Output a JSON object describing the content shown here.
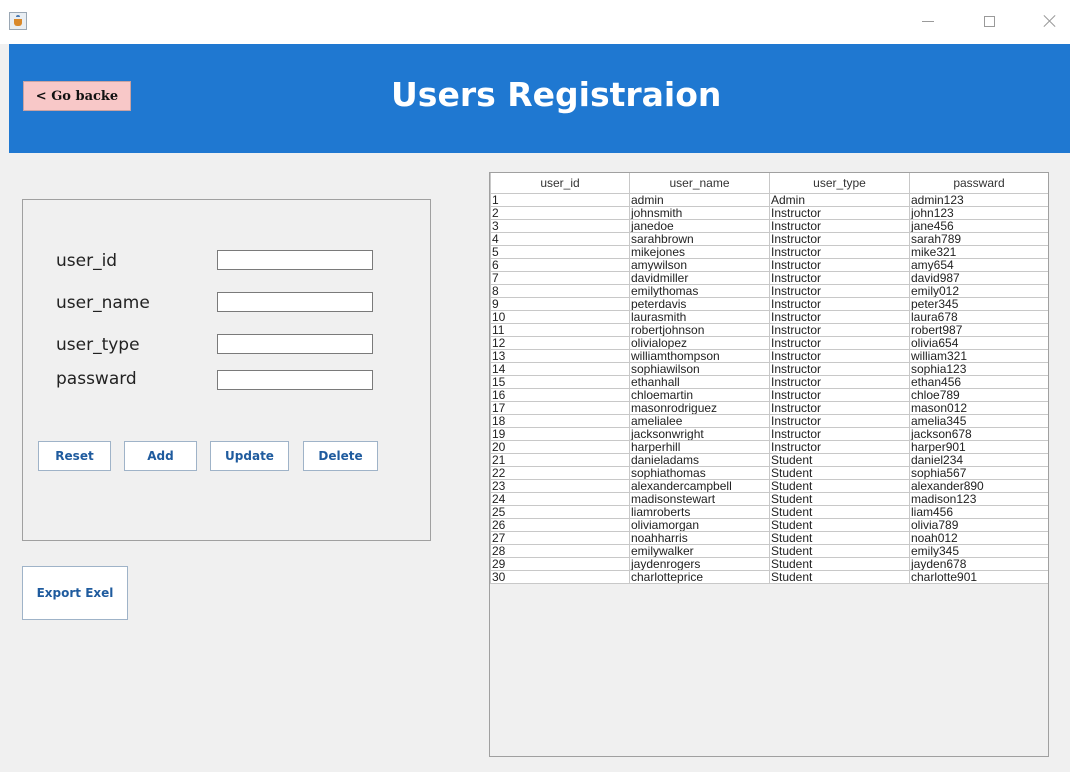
{
  "window": {
    "icon": "java-cup-icon",
    "controls": [
      "minimize-icon",
      "maximize-icon",
      "close-icon"
    ]
  },
  "header": {
    "back_label": "< Go backe",
    "title": "Users Registraion",
    "background": "#1f78d1"
  },
  "form": {
    "labels": {
      "user_id": "user_id",
      "user_name": "user_name",
      "user_type": "user_type",
      "passward": "passward"
    },
    "values": {
      "user_id": "",
      "user_name": "",
      "user_type": "",
      "passward": ""
    }
  },
  "actions": {
    "reset": "Reset",
    "add": "Add",
    "update": "Update",
    "delete": "Delete",
    "export": "Export Exel"
  },
  "table": {
    "columns": [
      "user_id",
      "user_name",
      "user_type",
      "passward"
    ],
    "rows": [
      [
        "1",
        "admin",
        "Admin",
        "admin123"
      ],
      [
        "2",
        "johnsmith",
        "Instructor",
        "john123"
      ],
      [
        "3",
        "janedoe",
        "Instructor",
        "jane456"
      ],
      [
        "4",
        "sarahbrown",
        "Instructor",
        "sarah789"
      ],
      [
        "5",
        "mikejones",
        "Instructor",
        "mike321"
      ],
      [
        "6",
        "amywilson",
        "Instructor",
        "amy654"
      ],
      [
        "7",
        "davidmiller",
        "Instructor",
        "david987"
      ],
      [
        "8",
        "emilythomas",
        "Instructor",
        "emily012"
      ],
      [
        "9",
        "peterdavis",
        "Instructor",
        "peter345"
      ],
      [
        "10",
        "laurasmith",
        "Instructor",
        "laura678"
      ],
      [
        "11",
        "robertjohnson",
        "Instructor",
        "robert987"
      ],
      [
        "12",
        "olivialopez",
        "Instructor",
        "olivia654"
      ],
      [
        "13",
        "williamthompson",
        "Instructor",
        "william321"
      ],
      [
        "14",
        "sophiawilson",
        "Instructor",
        "sophia123"
      ],
      [
        "15",
        "ethanhall",
        "Instructor",
        "ethan456"
      ],
      [
        "16",
        "chloemartin",
        "Instructor",
        "chloe789"
      ],
      [
        "17",
        "masonrodriguez",
        "Instructor",
        "mason012"
      ],
      [
        "18",
        "amelialee",
        "Instructor",
        "amelia345"
      ],
      [
        "19",
        "jacksonwright",
        "Instructor",
        "jackson678"
      ],
      [
        "20",
        "harperhill",
        "Instructor",
        "harper901"
      ],
      [
        "21",
        "danieladams",
        "Student",
        "daniel234"
      ],
      [
        "22",
        "sophiathomas",
        "Student",
        "sophia567"
      ],
      [
        "23",
        "alexandercampbell",
        "Student",
        "alexander890"
      ],
      [
        "24",
        "madisonstewart",
        "Student",
        "madison123"
      ],
      [
        "25",
        "liamroberts",
        "Student",
        "liam456"
      ],
      [
        "26",
        "oliviamorgan",
        "Student",
        "olivia789"
      ],
      [
        "27",
        "noahharris",
        "Student",
        "noah012"
      ],
      [
        "28",
        "emilywalker",
        "Student",
        "emily345"
      ],
      [
        "29",
        "jaydenrogers",
        "Student",
        "jayden678"
      ],
      [
        "30",
        "charlotteprice",
        "Student",
        "charlotte901"
      ]
    ]
  }
}
